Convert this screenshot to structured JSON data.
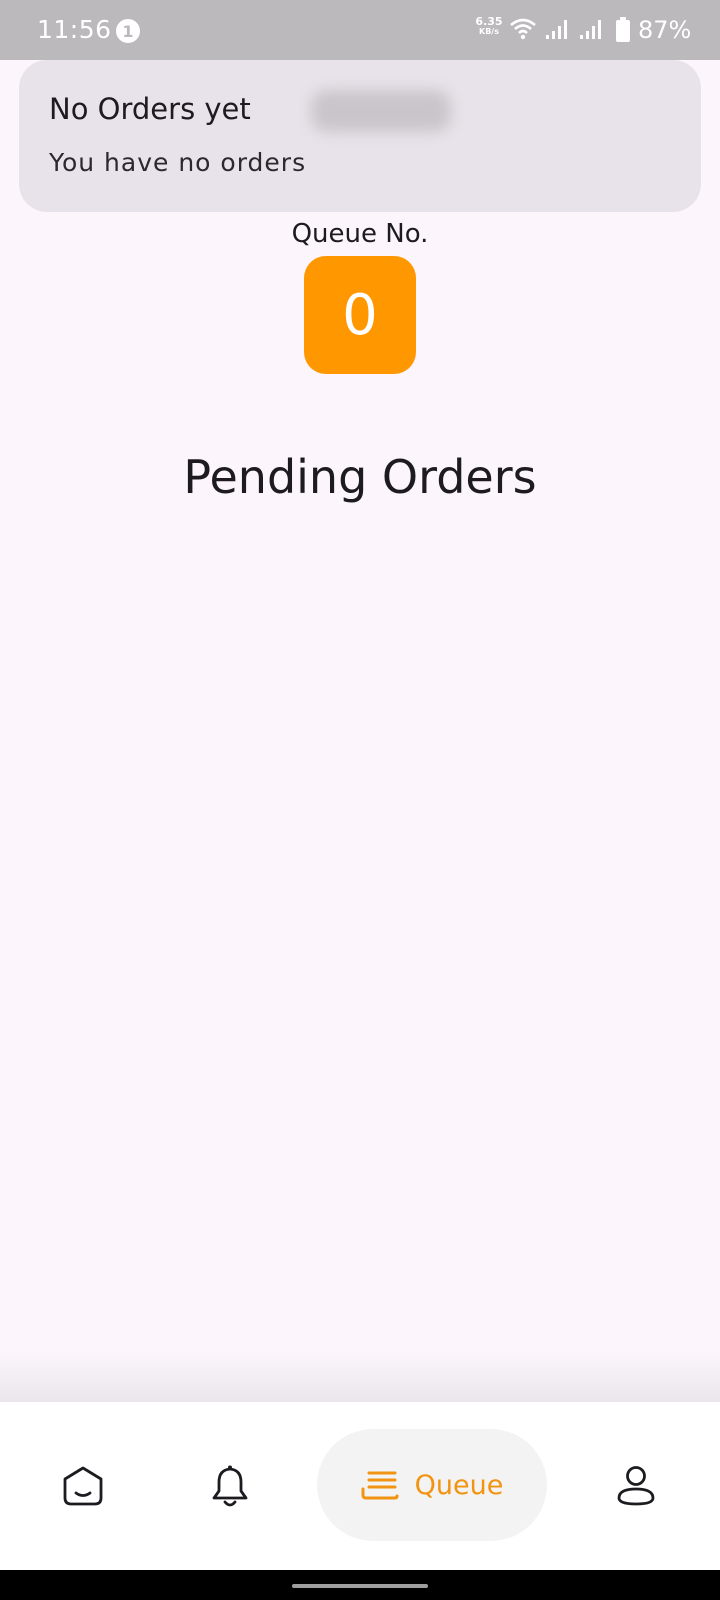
{
  "status_bar": {
    "time": "11:56",
    "notification_count": "1",
    "net_speed": "6.35",
    "net_speed_unit": "KB/s",
    "battery": "87%"
  },
  "notice": {
    "title": "No Orders yet",
    "body": "You have no orders"
  },
  "queue": {
    "label": "Queue No.",
    "number": "0"
  },
  "pending": {
    "title": "Pending Orders"
  },
  "bottom_nav": {
    "items": [
      {
        "icon": "home-icon"
      },
      {
        "icon": "bell-icon"
      },
      {
        "icon": "queue-icon",
        "label": "Queue",
        "active": true
      },
      {
        "icon": "profile-icon"
      }
    ],
    "active_color": "#f29411"
  },
  "colors": {
    "accent": "#ff9800",
    "background": "#fcf6fc",
    "card": "#e8e3ea"
  }
}
